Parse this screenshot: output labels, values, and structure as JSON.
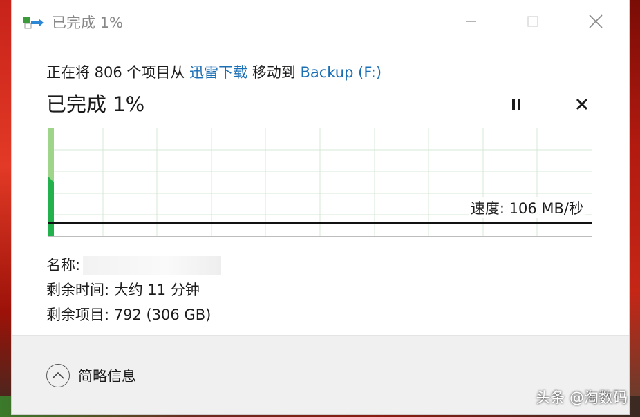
{
  "window": {
    "title": "已完成 1%",
    "icon": "move-files-icon"
  },
  "summary": {
    "prefix": "正在将 806 个项目从 ",
    "source": "迅雷下载",
    "middle": " 移动到 ",
    "destination": "Backup (F:)"
  },
  "progress": {
    "label": "已完成 1%",
    "percent": 1,
    "speed_label": "速度: 106 MB/秒"
  },
  "details": {
    "name_label": "名称:",
    "time_label": "剩余时间: 大约 11 分钟",
    "items_label": "剩余项目: 792 (306 GB)"
  },
  "footer": {
    "collapse_label": "简略信息"
  },
  "watermark": "头条 @淘数码",
  "colors": {
    "accent": "#1a6fb5",
    "progress_fill": "#9fd58a",
    "speed_fill": "#22b14c"
  }
}
